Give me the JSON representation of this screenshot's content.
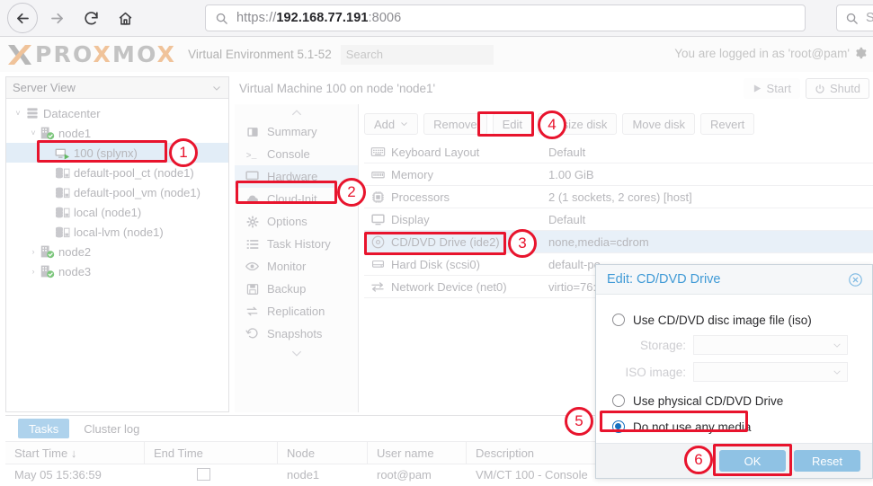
{
  "browser": {
    "back_icon": "back-arrow-icon",
    "forward_icon": "forward-arrow-icon",
    "reload_icon": "reload-icon",
    "home_icon": "home-icon",
    "url_scheme": "https://",
    "url_host": "192.168.77.191",
    "url_port": ":8006",
    "search_placeholder": "Se",
    "search_icon": "search-icon"
  },
  "pve_header": {
    "logo_x1": "X",
    "logo_pro": "PRO",
    "logo_x2": "X",
    "logo_mo": "MO",
    "logo_x3": "X",
    "version": "Virtual Environment 5.1-52",
    "search_placeholder": "Search",
    "user_status": "You are logged in as 'root@pam'",
    "gear_icon": "gear-icon"
  },
  "tree": {
    "header": "Server View",
    "header_chevron": "chevron-down-icon",
    "items": [
      {
        "label": "Datacenter",
        "indent": 0,
        "caret": "˅",
        "icon": "datacenter-icon",
        "selected": false
      },
      {
        "label": "node1",
        "indent": 1,
        "caret": "˅",
        "icon": "node-icon",
        "selected": false
      },
      {
        "label": "100 (splynx)",
        "indent": 2,
        "caret": "",
        "icon": "vm-icon",
        "selected": true
      },
      {
        "label": "default-pool_ct (node1)",
        "indent": 2,
        "caret": "",
        "icon": "storage-icon",
        "selected": false
      },
      {
        "label": "default-pool_vm (node1)",
        "indent": 2,
        "caret": "",
        "icon": "storage-icon",
        "selected": false
      },
      {
        "label": "local (node1)",
        "indent": 2,
        "caret": "",
        "icon": "storage-icon",
        "selected": false
      },
      {
        "label": "local-lvm (node1)",
        "indent": 2,
        "caret": "",
        "icon": "storage-icon",
        "selected": false
      },
      {
        "label": "node2",
        "indent": 1,
        "caret": "›",
        "icon": "node-icon",
        "selected": false
      },
      {
        "label": "node3",
        "indent": 1,
        "caret": "›",
        "icon": "node-icon",
        "selected": false
      }
    ]
  },
  "nav": {
    "scroll_up_icon": "chevron-up-icon",
    "scroll_down_icon": "chevron-down-icon",
    "items": [
      {
        "label": "Summary",
        "icon": "summary-icon",
        "selected": false
      },
      {
        "label": "Console",
        "icon": "console-icon",
        "selected": false
      },
      {
        "label": "Hardware",
        "icon": "hardware-icon",
        "selected": true
      },
      {
        "label": "Cloud-Init",
        "icon": "cloud-icon",
        "selected": false
      },
      {
        "label": "Options",
        "icon": "gear-icon",
        "selected": false
      },
      {
        "label": "Task History",
        "icon": "list-icon",
        "selected": false
      },
      {
        "label": "Monitor",
        "icon": "eye-icon",
        "selected": false
      },
      {
        "label": "Backup",
        "icon": "floppy-icon",
        "selected": false
      },
      {
        "label": "Replication",
        "icon": "replication-icon",
        "selected": false
      },
      {
        "label": "Snapshots",
        "icon": "history-icon",
        "selected": false
      }
    ]
  },
  "content": {
    "title": "Virtual Machine 100 on node 'node1'",
    "start_button": "Start",
    "start_icon": "play-icon",
    "shutdown_button": "Shutd",
    "shutdown_icon": "power-icon"
  },
  "toolbar": {
    "add_label": "Add",
    "add_chevron": "chevron-down-icon",
    "remove_label": "Remove",
    "edit_label": "Edit",
    "resize_label": "Resize disk",
    "move_label": "Move disk",
    "revert_label": "Revert"
  },
  "hardware": {
    "rows": [
      {
        "key": "Keyboard Layout",
        "value": "Default",
        "icon": "keyboard-icon",
        "selected": false
      },
      {
        "key": "Memory",
        "value": "1.00 GiB",
        "icon": "memory-icon",
        "selected": false
      },
      {
        "key": "Processors",
        "value": "2 (1 sockets, 2 cores) [host]",
        "icon": "cpu-icon",
        "selected": false
      },
      {
        "key": "Display",
        "value": "Default",
        "icon": "display-icon",
        "selected": false
      },
      {
        "key": "CD/DVD Drive (ide2)",
        "value": "none,media=cdrom",
        "icon": "cd-icon",
        "selected": true
      },
      {
        "key": "Hard Disk (scsi0)",
        "value": "default-po",
        "icon": "harddisk-icon",
        "selected": false
      },
      {
        "key": "Network Device (net0)",
        "value": "virtio=76:",
        "icon": "network-icon",
        "selected": false
      }
    ]
  },
  "dialog": {
    "title": "Edit: CD/DVD Drive",
    "close_icon": "close-circle-icon",
    "option_iso": "Use CD/DVD disc image file (iso)",
    "storage_label": "Storage:",
    "storage_value": "",
    "iso_label": "ISO image:",
    "iso_value": "",
    "option_physical": "Use physical CD/DVD Drive",
    "option_none": "Do not use any media",
    "ok_label": "OK",
    "reset_label": "Reset"
  },
  "tasks": {
    "tab_tasks": "Tasks",
    "tab_cluster": "Cluster log",
    "columns": [
      "Start Time ↓",
      "End Time",
      "Node",
      "User name",
      "Description"
    ],
    "rows": [
      {
        "start": "May 05 15:36:59",
        "end": "",
        "node": "node1",
        "user": "root@pam",
        "description": "VM/CT 100 - Console"
      }
    ]
  },
  "annotations": {
    "accent_color": "#e8142d",
    "markers": [
      "1",
      "2",
      "3",
      "4",
      "5",
      "6"
    ]
  }
}
